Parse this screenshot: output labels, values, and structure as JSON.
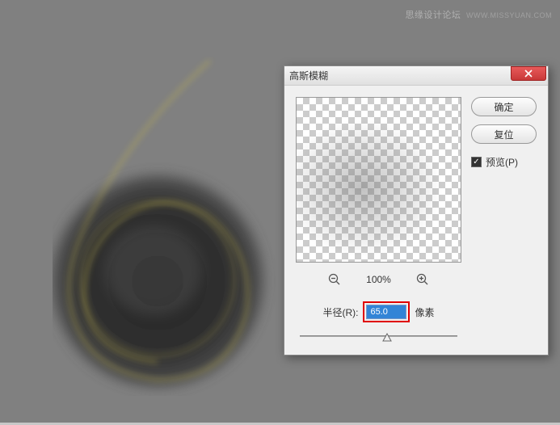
{
  "watermark": {
    "text": "思缘设计论坛",
    "url": "WWW.MISSYUAN.COM"
  },
  "dialog": {
    "title": "高斯模糊",
    "ok_label": "确定",
    "reset_label": "复位",
    "preview_label": "预览(P)",
    "preview_checked": true,
    "zoom_percent": "100%",
    "radius_label": "半径(R):",
    "radius_value": "65.0",
    "radius_unit": "像素"
  }
}
